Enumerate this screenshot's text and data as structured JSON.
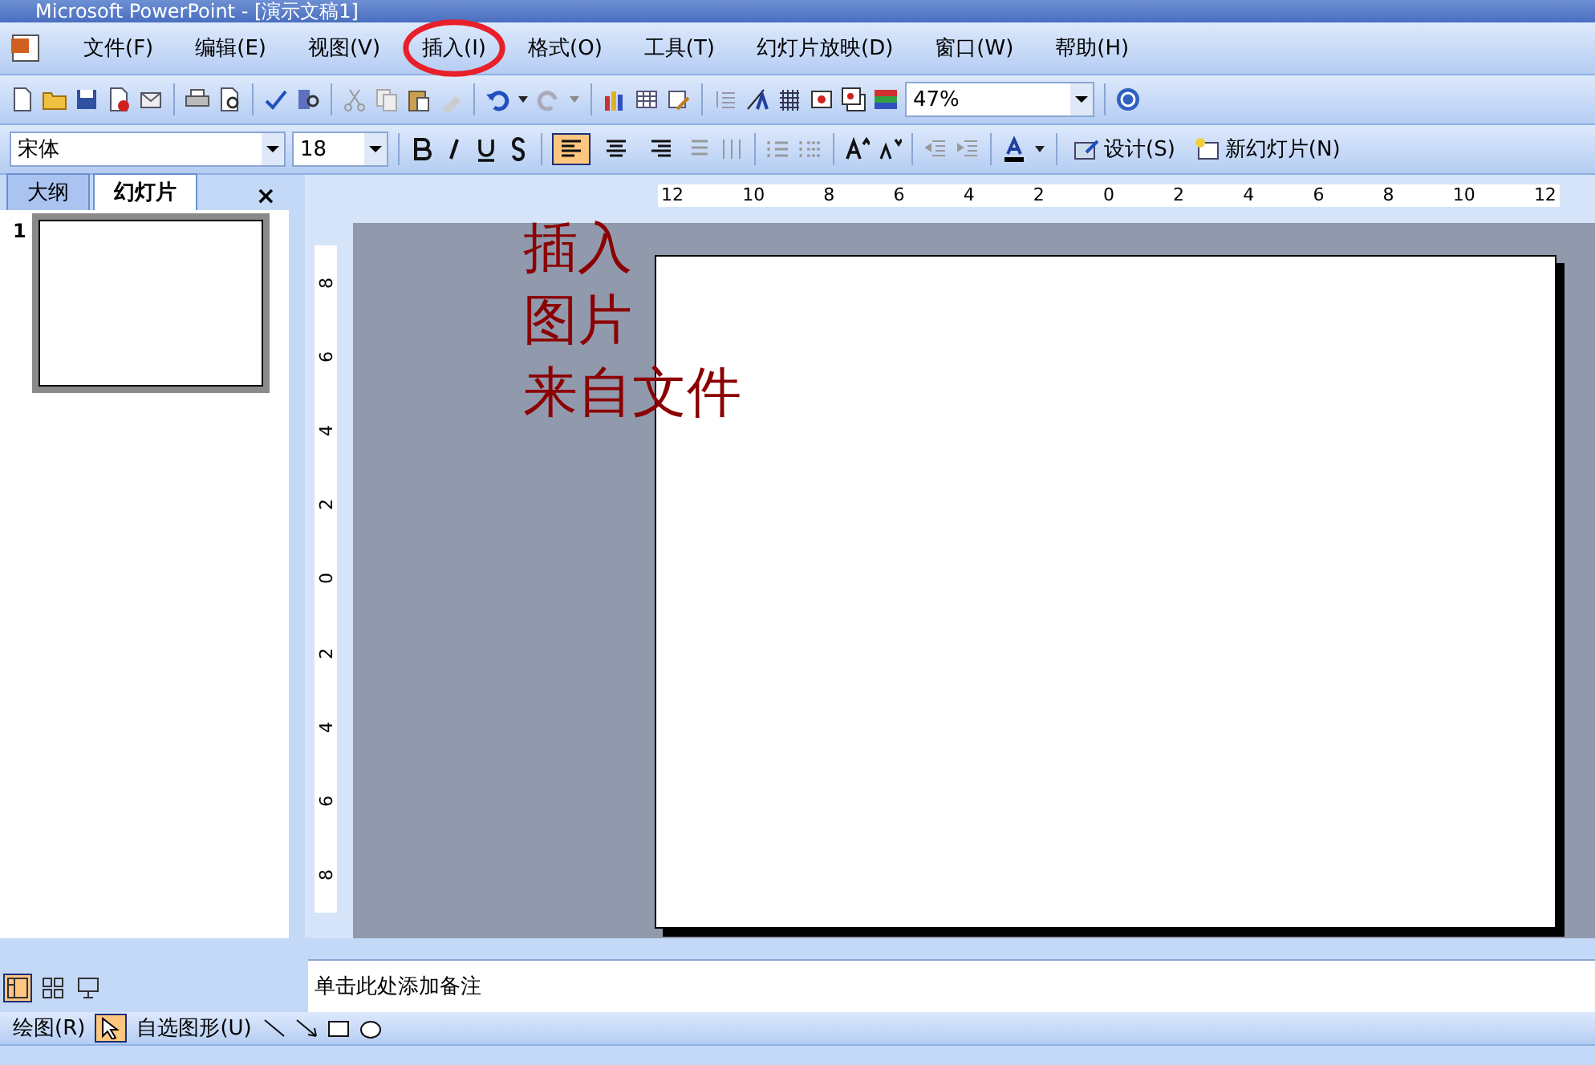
{
  "window": {
    "title": "Microsoft PowerPoint - [演示文稿1]"
  },
  "menu": [
    "文件(F)",
    "编辑(E)",
    "视图(V)",
    "插入(I)",
    "格式(O)",
    "工具(T)",
    "幻灯片放映(D)",
    "窗口(W)",
    "帮助(H)"
  ],
  "standard_toolbar": {
    "zoom": "47%"
  },
  "formatting_toolbar": {
    "font": "宋体",
    "size": "18",
    "align_buttons": [
      {
        "selected": true
      },
      {
        "selected": false
      },
      {
        "selected": false
      }
    ],
    "design": "设计(S)",
    "new_slide": "新幻灯片(N)"
  },
  "pane_tabs": [
    {
      "label": "大纲",
      "selected": false
    },
    {
      "label": "幻灯片",
      "selected": true
    }
  ],
  "pane_close": "×",
  "slides": [
    {
      "number": "1",
      "selected": true
    }
  ],
  "view_buttons": [
    {
      "selected": true
    },
    {
      "selected": false
    },
    {
      "selected": false
    }
  ],
  "ruler": {
    "horizontal": [
      "12",
      "10",
      "8",
      "6",
      "4",
      "2",
      "0",
      "2",
      "4",
      "6",
      "8",
      "10",
      "12"
    ],
    "vertical": [
      "8",
      "6",
      "4",
      "2",
      "0",
      "2",
      "4",
      "6",
      "8"
    ]
  },
  "annotation": {
    "lines": [
      "插入",
      "图片",
      "来自文件"
    ]
  },
  "notes": {
    "placeholder": "单击此处添加备注"
  },
  "drawing_toolbar": {
    "draw": "绘图(R)",
    "autoshapes": "自选图形(U)"
  }
}
